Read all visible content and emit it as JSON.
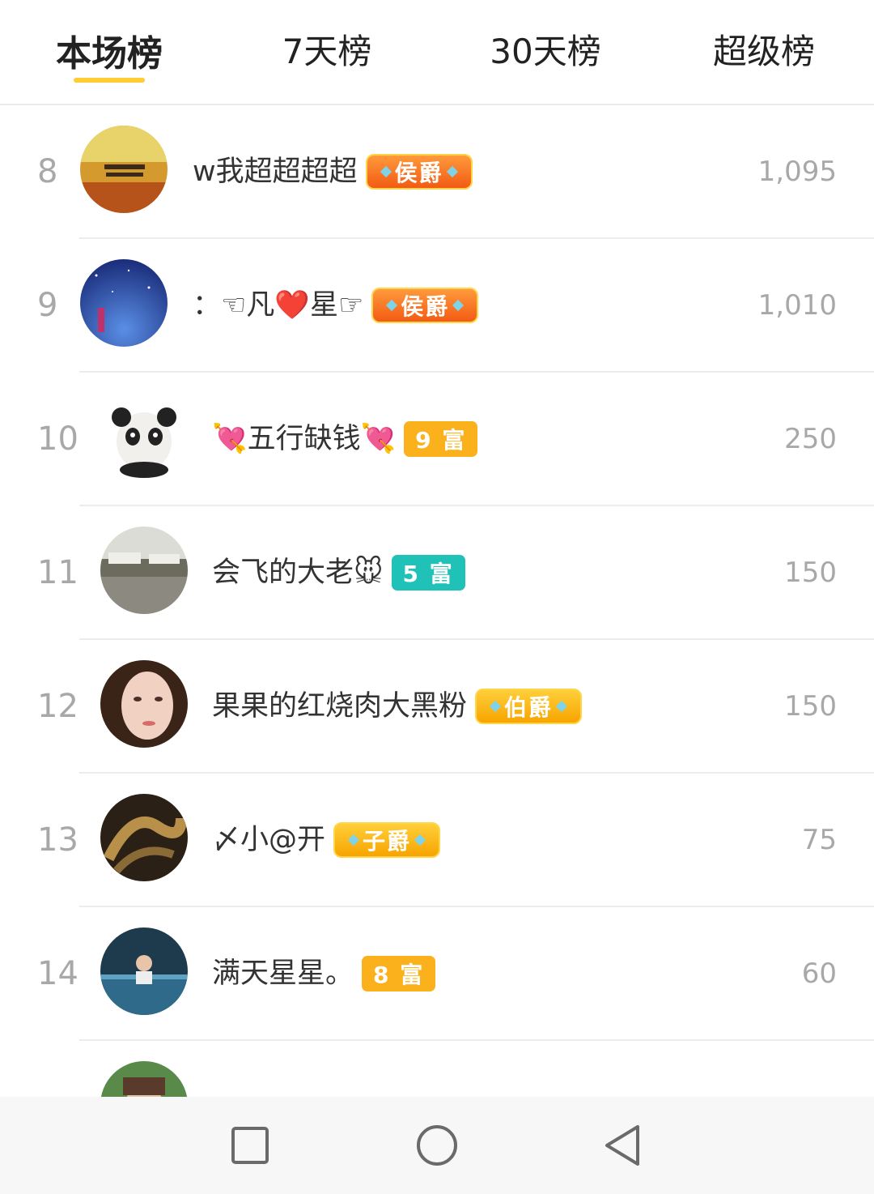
{
  "tabs": [
    {
      "label": "本场榜",
      "active": true
    },
    {
      "label": "7天榜",
      "active": false
    },
    {
      "label": "30天榜",
      "active": false
    },
    {
      "label": "超级榜",
      "active": false
    }
  ],
  "rows": [
    {
      "rank": "8",
      "name": "w我超超超超",
      "badge": "侯爵",
      "badge_type": "noble",
      "score": "1,095"
    },
    {
      "rank": "9",
      "name": "：☜凡❤️星☞",
      "badge": "侯爵",
      "badge_type": "noble",
      "score": "1,010"
    },
    {
      "rank": "10",
      "name": "💘五行缺钱💘",
      "badge": "9 富",
      "badge_type": "rich",
      "score": "250"
    },
    {
      "rank": "11",
      "name": "会飞的大老🐭",
      "badge": "5 富",
      "badge_type": "rich-teal",
      "score": "150"
    },
    {
      "rank": "12",
      "name": "果果的红烧肉大黑粉",
      "badge": "伯爵",
      "badge_type": "noble-gold",
      "score": "150"
    },
    {
      "rank": "13",
      "name": "〆小@开",
      "badge": "子爵",
      "badge_type": "noble-gold",
      "score": "75"
    },
    {
      "rank": "14",
      "name": "满天星星。",
      "badge": "8 富",
      "badge_type": "rich",
      "score": "60"
    }
  ],
  "colors": {
    "accent": "#ffcc33",
    "noble_badge": "#f25b14",
    "rich_badge": "#fbb11c",
    "rich_badge_teal": "#20c2b8"
  }
}
